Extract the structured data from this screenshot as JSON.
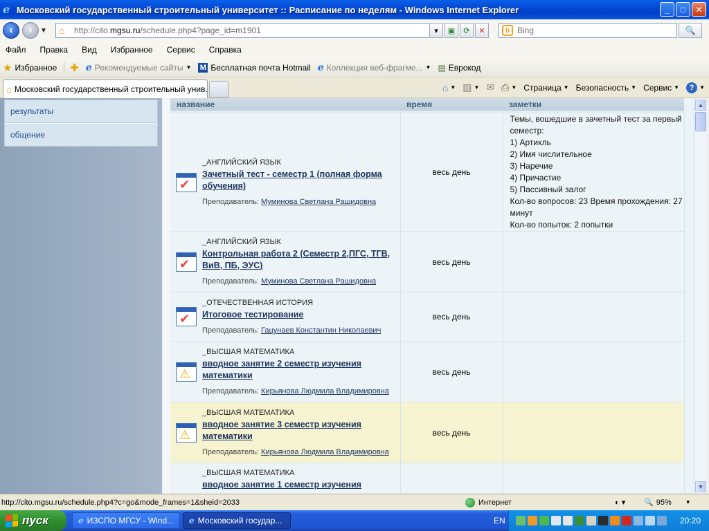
{
  "window": {
    "title": "Московский государственный строительный университет :: Расписание по неделям - Windows Internet Explorer",
    "controls": {
      "minimize": "_",
      "maximize": "□",
      "close": "✕"
    }
  },
  "address": {
    "url_prefix": "http://cito.",
    "url_host": "mgsu.ru",
    "url_rest": "/schedule.php4?page_id=m1901"
  },
  "search": {
    "placeholder": "Bing",
    "engine": "b"
  },
  "menu": [
    "Файл",
    "Правка",
    "Вид",
    "Избранное",
    "Сервис",
    "Справка"
  ],
  "favorites": {
    "label": "Избранное",
    "items": [
      {
        "label": "Рекомендуемые сайты",
        "dim": true
      },
      {
        "label": "Бесплатная почта Hotmail",
        "dim": false
      },
      {
        "label": "Коллекция веб-фрагме...",
        "dim": true
      },
      {
        "label": "Еврокод",
        "dim": false
      }
    ]
  },
  "tab": {
    "label": "Московский государственный строительный унив..."
  },
  "commandbar": {
    "page": "Страница",
    "safety": "Безопасность",
    "tools": "Сервис"
  },
  "sidebar": [
    "результаты",
    "общение"
  ],
  "table": {
    "headers": [
      "название",
      "время",
      "заметки"
    ],
    "rows": [
      {
        "course": "_АНГЛИЙСКИЙ ЯЗЫК",
        "title": "Зачетный тест - семестр 1 (полная форма обучения)",
        "teacher_label": "Преподаватель:",
        "teacher": "Муминова Светлана Рашидовна",
        "time": "весь день",
        "icon": "check",
        "notes": [
          "Темы, вошедшие в зачетный тест за первый семестр:",
          "1) Артикль",
          "2) Имя числительное",
          "3) Наречие",
          "4) Причастие",
          "5) Пассивный залог",
          "Кол-во вопросов: 23 Время прохождения: 27 минут",
          "Кол-во попыток: 2 попытки"
        ],
        "highlight": false
      },
      {
        "course": "_АНГЛИЙСКИЙ ЯЗЫК",
        "title": "Контрольная работа 2 (Семестр 2,ПГС, ТГВ, ВиВ, ПБ, ЭУС)",
        "teacher_label": "Преподаватель:",
        "teacher": "Муминова Светлана Рашидовна",
        "time": "весь день",
        "icon": "check",
        "notes": [],
        "highlight": false
      },
      {
        "course": "_ОТЕЧЕСТВЕННАЯ ИСТОРИЯ",
        "title": "Итоговое тестирование",
        "teacher_label": "Преподаватель:",
        "teacher": "Гацунаев Константин Николаевич",
        "time": "весь день",
        "icon": "check",
        "notes": [],
        "highlight": false
      },
      {
        "course": "_ВЫСШАЯ МАТЕМАТИКА",
        "title": "вводное занятие 2 семестр изучения математики",
        "teacher_label": "Преподаватель:",
        "teacher": "Кирьянова Людмила Владимировна",
        "time": "весь день",
        "icon": "warn",
        "notes": [],
        "highlight": false
      },
      {
        "course": "_ВЫСШАЯ МАТЕМАТИКА",
        "title": "вводное занятие 3 семестр изучения математики",
        "teacher_label": "Преподаватель:",
        "teacher": "Кирьянова Людмила Владимировна",
        "time": "весь день",
        "icon": "warn",
        "notes": [],
        "highlight": true
      },
      {
        "course": "_ВЫСШАЯ МАТЕМАТИКА",
        "title": "вводное занятие 1 семестр изучения",
        "teacher_label": "",
        "teacher": "",
        "time": "",
        "icon": "warn",
        "notes": [],
        "highlight": false
      }
    ]
  },
  "status": {
    "url": "http://cito.mgsu.ru/schedule.php4?c=go&mode_frames=1&sheid=2033",
    "zone": "Интернет",
    "zoom": "95%"
  },
  "taskbar": {
    "start": "пуск",
    "items": [
      "ИЗСПО МГСУ - Wind...",
      "Московский государ..."
    ],
    "lang": "EN",
    "time": "20:20"
  },
  "colors": {
    "titlebar": "#0449d4",
    "taskbar": "#245edb",
    "start": "#2f8f2f",
    "highlight_row": "#f6f3d1"
  }
}
